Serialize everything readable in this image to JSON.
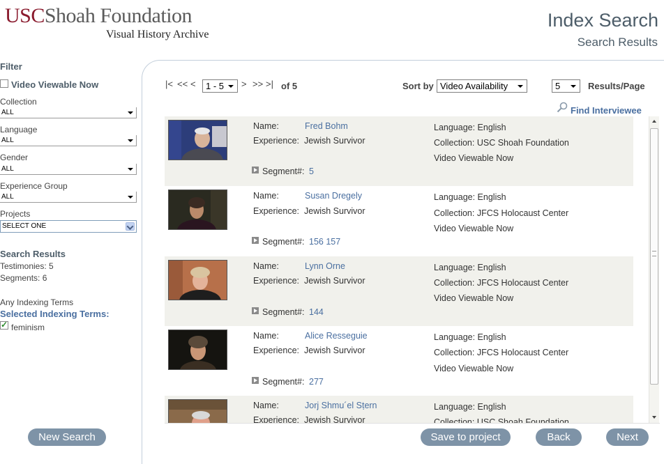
{
  "header": {
    "logo_usc": "USC",
    "logo_rest": "Shoah Foundation",
    "logo_subtitle": "Visual History Archive",
    "title": "Index Search",
    "subtitle": "Search Results"
  },
  "filter": {
    "title": "Filter",
    "video_viewable_label": "Video Viewable Now",
    "video_viewable_checked": false,
    "collection_label": "Collection",
    "collection_value": "ALL",
    "language_label": "Language",
    "language_value": "ALL",
    "gender_label": "Gender",
    "gender_value": "ALL",
    "experience_label": "Experience Group",
    "experience_value": "ALL",
    "projects_label": "Projects",
    "projects_value": "SELECT ONE"
  },
  "summary": {
    "title": "Search Results",
    "testimonies": "Testimonies: 5",
    "segments": "Segments: 6",
    "any_terms": "Any Indexing Terms",
    "selected_terms_label": "Selected Indexing Terms:",
    "terms": [
      {
        "label": "feminism",
        "checked": true
      }
    ]
  },
  "pager": {
    "first": "|<",
    "prev_page": "<<",
    "prev": "<",
    "range_value": "1 - 5",
    "next": ">",
    "next_page": ">>",
    "last": ">|",
    "of_text": "of 5",
    "sort_label": "Sort by",
    "sort_value": "Video Availability",
    "per_page_value": "5",
    "per_page_label": "Results/Page",
    "find_label": "Find Interviewee"
  },
  "labels": {
    "name": "Name:",
    "experience": "Experience:",
    "segment": "Segment#:"
  },
  "results": [
    {
      "name": "Fred Bohm",
      "experience": "Jewish Survivor",
      "segments": "5",
      "language": "Language: English",
      "collection": "Collection: USC Shoah Foundation",
      "viewable": "Video Viewable Now"
    },
    {
      "name": "Susan Dregely",
      "experience": "Jewish Survivor",
      "segments": "156 157",
      "language": "Language: English",
      "collection": "Collection: JFCS Holocaust Center",
      "viewable": "Video Viewable Now"
    },
    {
      "name": "Lynn Orne",
      "experience": "Jewish Survivor",
      "segments": "144",
      "language": "Language: English",
      "collection": "Collection: JFCS Holocaust Center",
      "viewable": "Video Viewable Now"
    },
    {
      "name": "Alice Resseguie",
      "experience": "Jewish Survivor",
      "segments": "277",
      "language": "Language: English",
      "collection": "Collection: JFCS Holocaust Center",
      "viewable": "Video Viewable Now"
    },
    {
      "name": "Jorj Shmu´el Sṭern",
      "experience": "Jewish Survivor",
      "segments": "",
      "language": "Language: English",
      "collection": "Collection: USC Shoah Foundation",
      "viewable": ""
    }
  ],
  "buttons": {
    "new_search": "New Search",
    "save_project": "Save to project",
    "back": "Back",
    "next": "Next"
  },
  "colors": {
    "brand_red": "#8a1b2e",
    "link_blue": "#4a6fa0",
    "button_gray": "#7e93a7",
    "row_shade": "#f1f1ec"
  }
}
